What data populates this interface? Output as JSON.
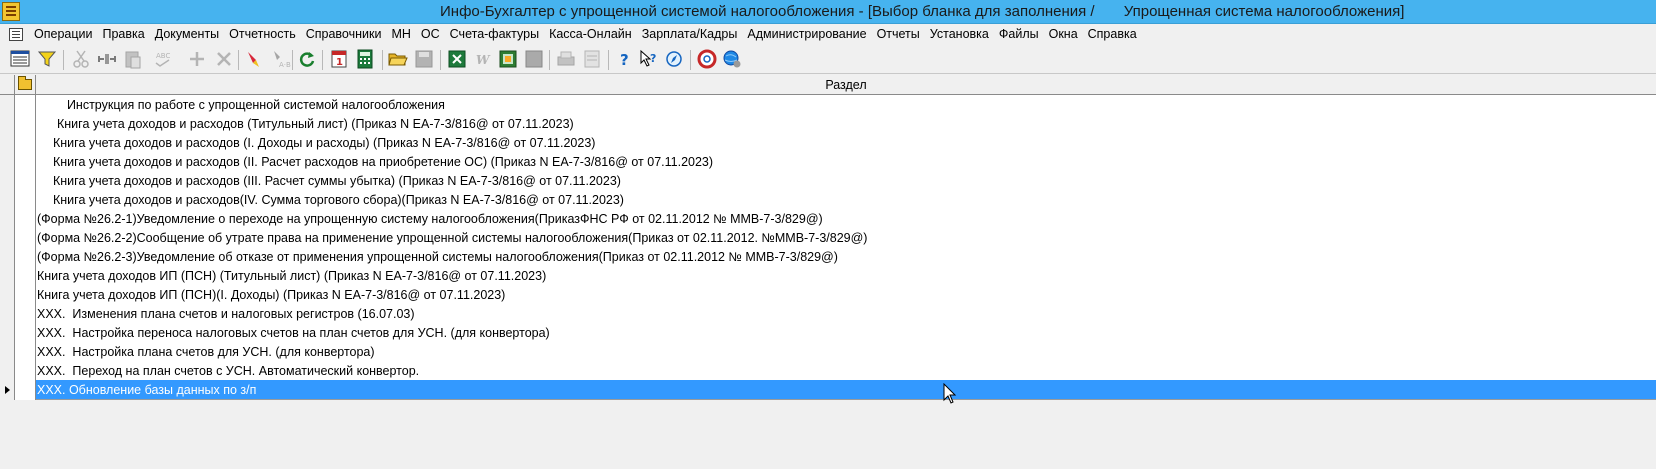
{
  "window": {
    "title": "Инфо-Бухгалтер с упрощенной системой налогообложения - [Выбор бланка для заполнения /       Упрощенная система налогообложения]"
  },
  "menubar": {
    "items": [
      "Операции",
      "Правка",
      "Документы",
      "Отчетность",
      "Справочники",
      "МН",
      "ОС",
      "Счета-фактуры",
      "Касса-Онлайн",
      "Зарплата/Кадры",
      "Администрирование",
      "Отчеты",
      "Установка",
      "Файлы",
      "Окна",
      "Справка"
    ]
  },
  "toolbar": {
    "buttons": [
      {
        "icon": "form-view-icon",
        "enabled": true
      },
      {
        "icon": "filter-icon",
        "enabled": true
      },
      {
        "icon": "cut-icon",
        "enabled": false
      },
      {
        "icon": "copy-icon",
        "enabled": false
      },
      {
        "icon": "paste-icon",
        "enabled": false
      },
      {
        "icon": "spelling-icon",
        "enabled": false
      },
      {
        "icon": "add-icon",
        "enabled": false
      },
      {
        "icon": "delete-icon",
        "enabled": false
      },
      {
        "icon": "mark-icon",
        "enabled": true
      },
      {
        "icon": "replace-icon",
        "enabled": false
      },
      {
        "icon": "refresh-icon",
        "enabled": true
      },
      {
        "icon": "calendar-icon",
        "enabled": true
      },
      {
        "icon": "calculator-icon",
        "enabled": true
      },
      {
        "icon": "open-folder-icon",
        "enabled": true
      },
      {
        "icon": "save-icon",
        "enabled": false
      },
      {
        "icon": "excel-icon",
        "enabled": true
      },
      {
        "icon": "word-icon",
        "enabled": false
      },
      {
        "icon": "export-icon",
        "enabled": true
      },
      {
        "icon": "import-icon",
        "enabled": false
      },
      {
        "icon": "print-icon",
        "enabled": false
      },
      {
        "icon": "preview-icon",
        "enabled": false
      },
      {
        "icon": "help-icon",
        "enabled": true
      },
      {
        "icon": "context-help-icon",
        "enabled": true
      },
      {
        "icon": "compass-icon",
        "enabled": true
      },
      {
        "icon": "support-icon",
        "enabled": true
      },
      {
        "icon": "web-update-icon",
        "enabled": true
      }
    ],
    "calendar_label": "1",
    "spelling_label": "ABC"
  },
  "grid": {
    "header": "Раздел",
    "rows": [
      {
        "text": "  Инструкция по работе с упрощенной системой налогообложения",
        "indent": "deep"
      },
      {
        "text": "Книга учета доходов и расходов (Титульный лист) (Приказ N ЕА-7-3/816@ от 07.11.2023)",
        "indent": "mid2"
      },
      {
        "text": "Книга учета доходов и расходов (I. Доходы и расходы) (Приказ N ЕА-7-3/816@ от 07.11.2023)",
        "indent": "mid"
      },
      {
        "text": "Книга учета доходов и расходов (II. Расчет расходов на приобретение ОС) (Приказ N ЕА-7-3/816@ от 07.11.2023)",
        "indent": "mid"
      },
      {
        "text": "Книга учета доходов и расходов (III. Расчет суммы убытка) (Приказ N ЕА-7-3/816@ от 07.11.2023)",
        "indent": "mid"
      },
      {
        "text": "Книга учета доходов и расходов(IV. Сумма торгового сбора)(Приказ N ЕА-7-3/816@ от 07.11.2023)",
        "indent": "mid"
      },
      {
        "text": "(Форма №26.2-1)Уведомление о переходе на упрощенную систему налогообложения(ПриказФНС РФ от 02.11.2012 № ММВ-7-3/829@)",
        "indent": "none"
      },
      {
        "text": "(Форма №26.2-2)Сообщение об утрате права на применение упрощенной системы налогообложения(Приказ от 02.11.2012. №ММВ-7-3/829@)",
        "indent": "none"
      },
      {
        "text": "(Форма №26.2-3)Уведомление об отказе от применения упрощенной системы налогообложения(Приказ от 02.11.2012 № ММВ-7-3/829@)",
        "indent": "none"
      },
      {
        "text": "Книга учета доходов ИП (ПСН) (Титульный лист) (Приказ N ЕА-7-3/816@ от 07.11.2023)",
        "indent": "none"
      },
      {
        "text": "Книга учета доходов ИП (ПСН)(I. Доходы) (Приказ N ЕА-7-3/816@ от 07.11.2023)",
        "indent": "none"
      },
      {
        "text": "XXX.  Изменения плана счетов и налоговых регистров (16.07.03)",
        "indent": "none"
      },
      {
        "text": "XXX.  Настройка переноса налоговых счетов на план счетов для УСН. (для конвертора)",
        "indent": "none"
      },
      {
        "text": "XXX.  Настройка плана счетов для УСН. (для конвертора)",
        "indent": "none"
      },
      {
        "text": "XXX.  Переход на план счетов с УСН. Автоматический конвертор.",
        "indent": "none"
      },
      {
        "text": "XXX. Обновление базы данных по з/п",
        "indent": "none",
        "selected": true
      }
    ]
  },
  "colors": {
    "titlebar": "#46b3ef",
    "selection": "#3399ff",
    "window_bg": "#f0f0f0"
  }
}
